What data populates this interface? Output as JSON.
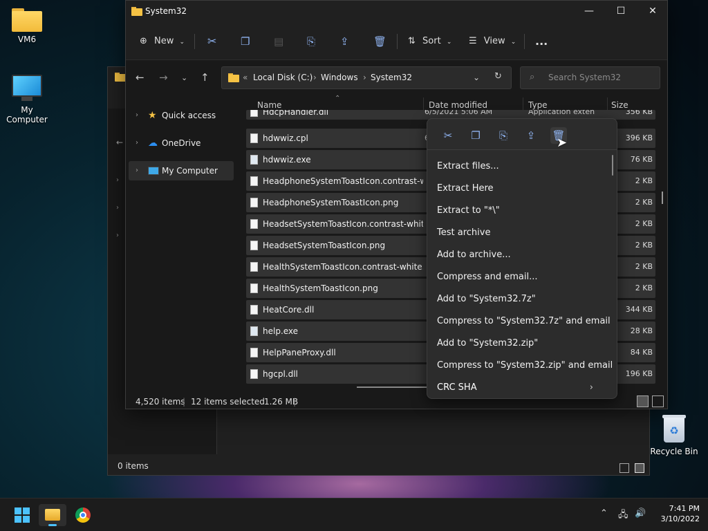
{
  "desktop": {
    "icons": [
      {
        "label": "VM6"
      },
      {
        "label": "My Computer"
      },
      {
        "label": "Recycle Bin"
      }
    ]
  },
  "bg_window": {
    "status": "0 items"
  },
  "window": {
    "title": "System32",
    "toolbar": {
      "new_label": "New",
      "sort_label": "Sort",
      "view_label": "View",
      "more_label": "..."
    },
    "address": {
      "prefix": "«",
      "crumbs": [
        "Local Disk (C:)",
        "Windows",
        "System32"
      ]
    },
    "search": {
      "placeholder": "Search System32"
    },
    "nav": [
      {
        "label": "Quick access"
      },
      {
        "label": "OneDrive"
      },
      {
        "label": "My Computer"
      }
    ],
    "columns": {
      "name": "Name",
      "date": "Date modified",
      "type": "Type",
      "size": "Size"
    },
    "partial_row": {
      "name": "HdcpHandler.dll",
      "date": "6/5/2021 5:06 AM",
      "type": "Application exten",
      "size": "356 KB"
    },
    "files": [
      {
        "name": "hdwwiz.cpl",
        "date": "6",
        "size": "396 KB"
      },
      {
        "name": "hdwwiz.exe",
        "size": "76 KB"
      },
      {
        "name": "HeadphoneSystemToastIcon.contrast-wh...",
        "size": "2 KB"
      },
      {
        "name": "HeadphoneSystemToastIcon.png",
        "size": "2 KB"
      },
      {
        "name": "HeadsetSystemToastIcon.contrast-white....",
        "size": "2 KB"
      },
      {
        "name": "HeadsetSystemToastIcon.png",
        "size": "2 KB"
      },
      {
        "name": "HealthSystemToastIcon.contrast-white.p...",
        "size": "2 KB"
      },
      {
        "name": "HealthSystemToastIcon.png",
        "size": "2 KB"
      },
      {
        "name": "HeatCore.dll",
        "size": "344 KB"
      },
      {
        "name": "help.exe",
        "size": "28 KB"
      },
      {
        "name": "HelpPaneProxy.dll",
        "size": "84 KB"
      },
      {
        "name": "hgcpl.dll",
        "size": "196 KB"
      }
    ],
    "status": {
      "count": "4,520 items",
      "selected": "12 items selected",
      "size": "1.26 MB"
    }
  },
  "context_menu": {
    "items": [
      {
        "label": "Extract files..."
      },
      {
        "label": "Extract Here"
      },
      {
        "label": "Extract to \"*\\\""
      },
      {
        "label": "Test archive"
      },
      {
        "label": "Add to archive..."
      },
      {
        "label": "Compress and email..."
      },
      {
        "label": "Add to \"System32.7z\""
      },
      {
        "label": "Compress to \"System32.7z\" and email"
      },
      {
        "label": "Add to \"System32.zip\""
      },
      {
        "label": "Compress to \"System32.zip\" and email"
      },
      {
        "label": "CRC SHA"
      }
    ]
  },
  "taskbar": {
    "time": "7:41 PM",
    "date": "3/10/2022"
  },
  "colors": {
    "accent": "#4cc2ff",
    "folder": "#f5c244",
    "row_selected": "#333333"
  }
}
